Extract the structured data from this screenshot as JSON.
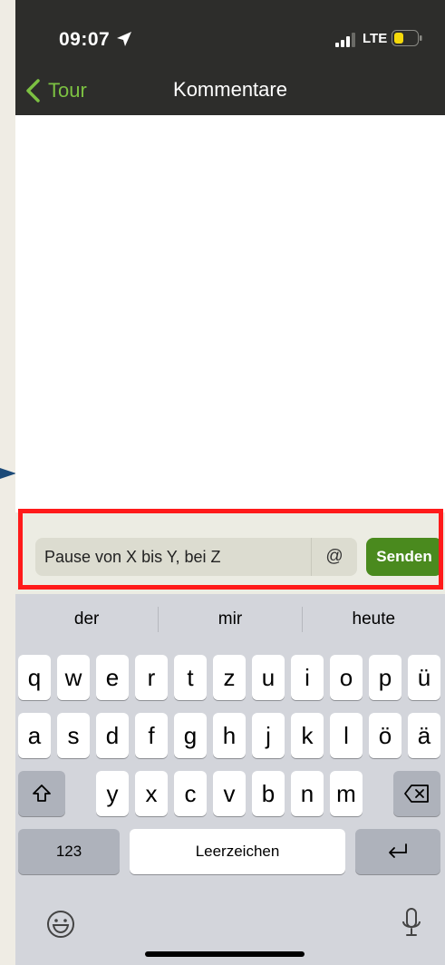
{
  "status_bar": {
    "time": "09:07",
    "network": "LTE"
  },
  "nav": {
    "back_label": "Tour",
    "title": "Kommentare"
  },
  "comment_bar": {
    "input_value": "Pause von X bis Y, bei Z",
    "mention_symbol": "@",
    "send_label": "Senden"
  },
  "keyboard": {
    "suggestions": [
      "der",
      "mir",
      "heute"
    ],
    "row1": [
      "q",
      "w",
      "e",
      "r",
      "t",
      "z",
      "u",
      "i",
      "o",
      "p",
      "ü"
    ],
    "row2": [
      "a",
      "s",
      "d",
      "f",
      "g",
      "h",
      "j",
      "k",
      "l",
      "ö",
      "ä"
    ],
    "row3": [
      "y",
      "x",
      "c",
      "v",
      "b",
      "n",
      "m"
    ],
    "numbers_label": "123",
    "space_label": "Leerzeichen"
  },
  "colors": {
    "accent": "#7cc142",
    "send": "#4a8a1e",
    "highlight": "#ff1a1a"
  }
}
